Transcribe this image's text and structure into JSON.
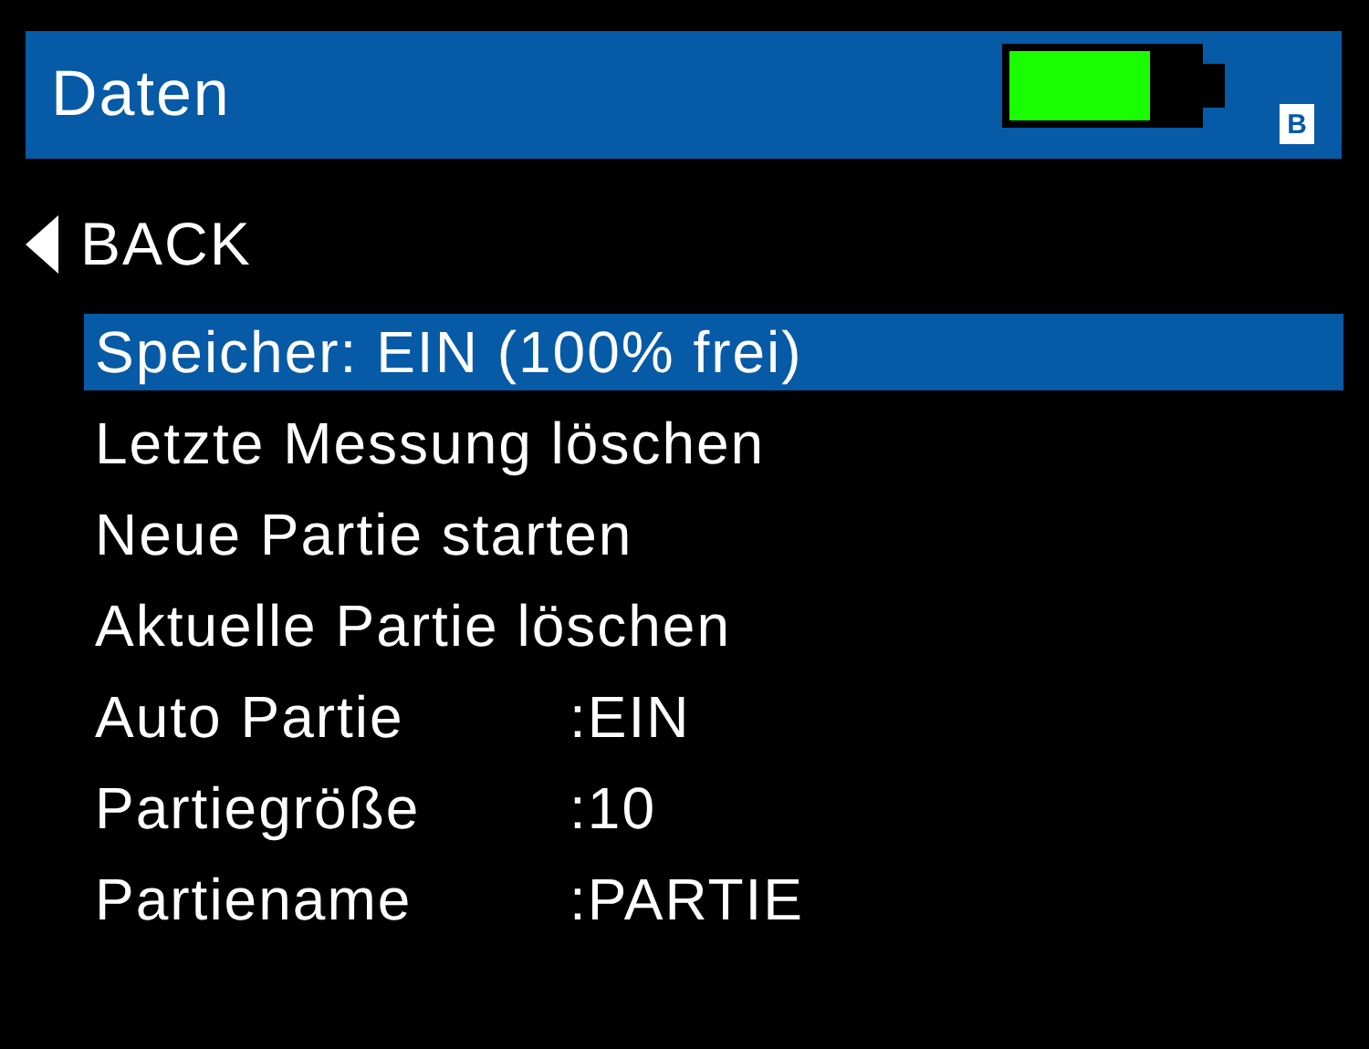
{
  "header": {
    "title": "Daten",
    "badge": "B"
  },
  "back": {
    "label": "BACK"
  },
  "menu": [
    {
      "kind": "action",
      "label": "Speicher: EIN (100% frei)",
      "selected": true
    },
    {
      "kind": "action",
      "label": "Letzte Messung löschen",
      "selected": false
    },
    {
      "kind": "action",
      "label": "Neue Partie starten",
      "selected": false
    },
    {
      "kind": "action",
      "label": "Aktuelle Partie löschen",
      "selected": false
    },
    {
      "kind": "setting",
      "label": "Auto Partie",
      "value": ":EIN",
      "selected": false
    },
    {
      "kind": "setting",
      "label": "Partiegröße",
      "value": ":10",
      "selected": false
    },
    {
      "kind": "setting",
      "label": "Partiename",
      "value": ":PARTIE",
      "selected": false
    }
  ]
}
